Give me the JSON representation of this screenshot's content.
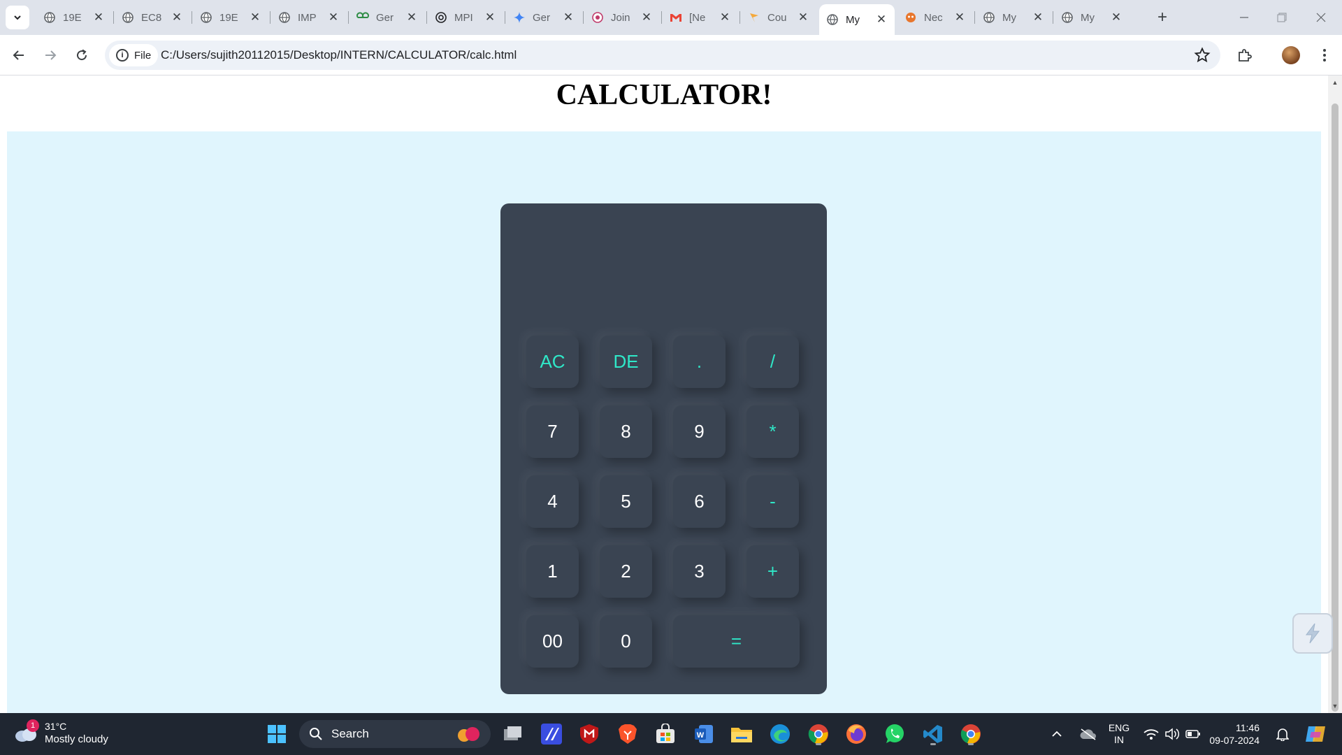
{
  "browser": {
    "tabs": [
      {
        "title": "19E",
        "icon": "globe-icon"
      },
      {
        "title": "EC8",
        "icon": "globe-icon"
      },
      {
        "title": "19E",
        "icon": "globe-icon"
      },
      {
        "title": "IMP",
        "icon": "globe-icon"
      },
      {
        "title": "Ger",
        "icon": "geeksforgeeks-icon"
      },
      {
        "title": "MPI",
        "icon": "openai-icon"
      },
      {
        "title": "Ger",
        "icon": "gemini-icon"
      },
      {
        "title": "Join",
        "icon": "join-icon"
      },
      {
        "title": "[Ne",
        "icon": "gmail-icon"
      },
      {
        "title": "Cou",
        "icon": "course-icon"
      },
      {
        "title": "My",
        "icon": "globe-icon",
        "active": true
      },
      {
        "title": "Nec",
        "icon": "neo-icon"
      },
      {
        "title": "My",
        "icon": "globe-icon"
      },
      {
        "title": "My",
        "icon": "globe-icon"
      }
    ],
    "close_glyph": "✕",
    "new_tab_glyph": "+",
    "site_chip_label": "File",
    "url": "C:/Users/sujith20112015/Desktop/INTERN/CALCULATOR/calc.html"
  },
  "page": {
    "title": "CALCULATOR!",
    "display_value": "",
    "keys": [
      {
        "label": "AC",
        "type": "op"
      },
      {
        "label": "DE",
        "type": "op"
      },
      {
        "label": ".",
        "type": "op"
      },
      {
        "label": "/",
        "type": "op"
      },
      {
        "label": "7",
        "type": "num"
      },
      {
        "label": "8",
        "type": "num"
      },
      {
        "label": "9",
        "type": "num"
      },
      {
        "label": "*",
        "type": "op"
      },
      {
        "label": "4",
        "type": "num"
      },
      {
        "label": "5",
        "type": "num"
      },
      {
        "label": "6",
        "type": "num"
      },
      {
        "label": "-",
        "type": "op"
      },
      {
        "label": "1",
        "type": "num"
      },
      {
        "label": "2",
        "type": "num"
      },
      {
        "label": "3",
        "type": "num"
      },
      {
        "label": "+",
        "type": "op"
      },
      {
        "label": "00",
        "type": "num"
      },
      {
        "label": "0",
        "type": "num"
      },
      {
        "label": "=",
        "type": "op"
      }
    ],
    "colors": {
      "calculator_body": "#3a4452",
      "operator_text": "#2fe8c8",
      "page_background": "#e0f5fd"
    }
  },
  "taskbar": {
    "weather": {
      "temp": "31°C",
      "condition": "Mostly cloudy",
      "badge": "1"
    },
    "search_label": "Search",
    "language": {
      "line1": "ENG",
      "line2": "IN"
    },
    "clock": {
      "time": "11:46",
      "date": "09-07-2024"
    }
  }
}
